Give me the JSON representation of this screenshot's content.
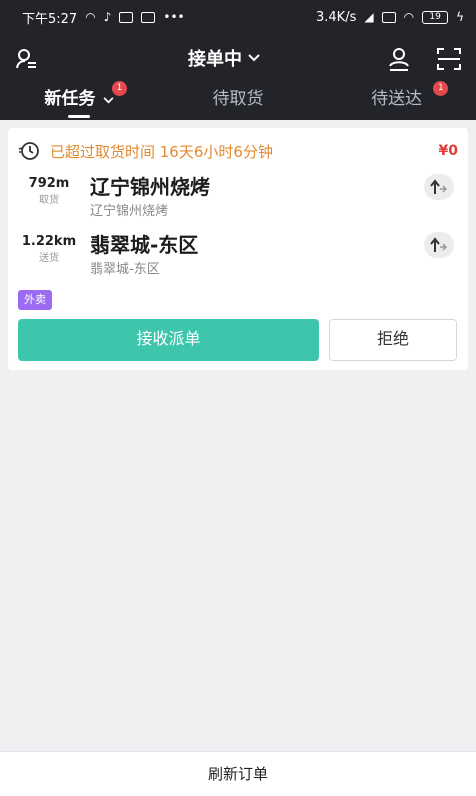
{
  "status_bar": {
    "time": "下午5:27",
    "network_speed": "3.4K/s",
    "battery_level": "19"
  },
  "header": {
    "title": "接单中"
  },
  "tabs": [
    {
      "label": "新任务",
      "badge": "1",
      "active": true
    },
    {
      "label": "待取货",
      "active": false
    },
    {
      "label": "待送达",
      "badge": "1",
      "active": false
    }
  ],
  "order": {
    "warning": "已超过取货时间 16天6小时6分钟",
    "price": "¥0",
    "pickup": {
      "distance": "792m",
      "label": "取货",
      "name": "辽宁锦州烧烤",
      "address": "辽宁锦州烧烤"
    },
    "delivery": {
      "distance": "1.22km",
      "label": "送货",
      "name": "翡翠城-东区",
      "address": "翡翠城-东区"
    },
    "tag": "外卖",
    "accept_label": "接收派单",
    "reject_label": "拒绝"
  },
  "footer": {
    "refresh_label": "刷新订单"
  },
  "colors": {
    "header_bg": "#23242a",
    "accent": "#3ec6ad",
    "warning": "#e38a2f",
    "price": "#e23b3b",
    "tag": "#9b6cf3",
    "badge": "#e5484d"
  },
  "icons": [
    "person-list-icon",
    "chevron-down-icon",
    "user-location-icon",
    "scan-icon",
    "clock-icon",
    "navigation-arrow-icon"
  ]
}
